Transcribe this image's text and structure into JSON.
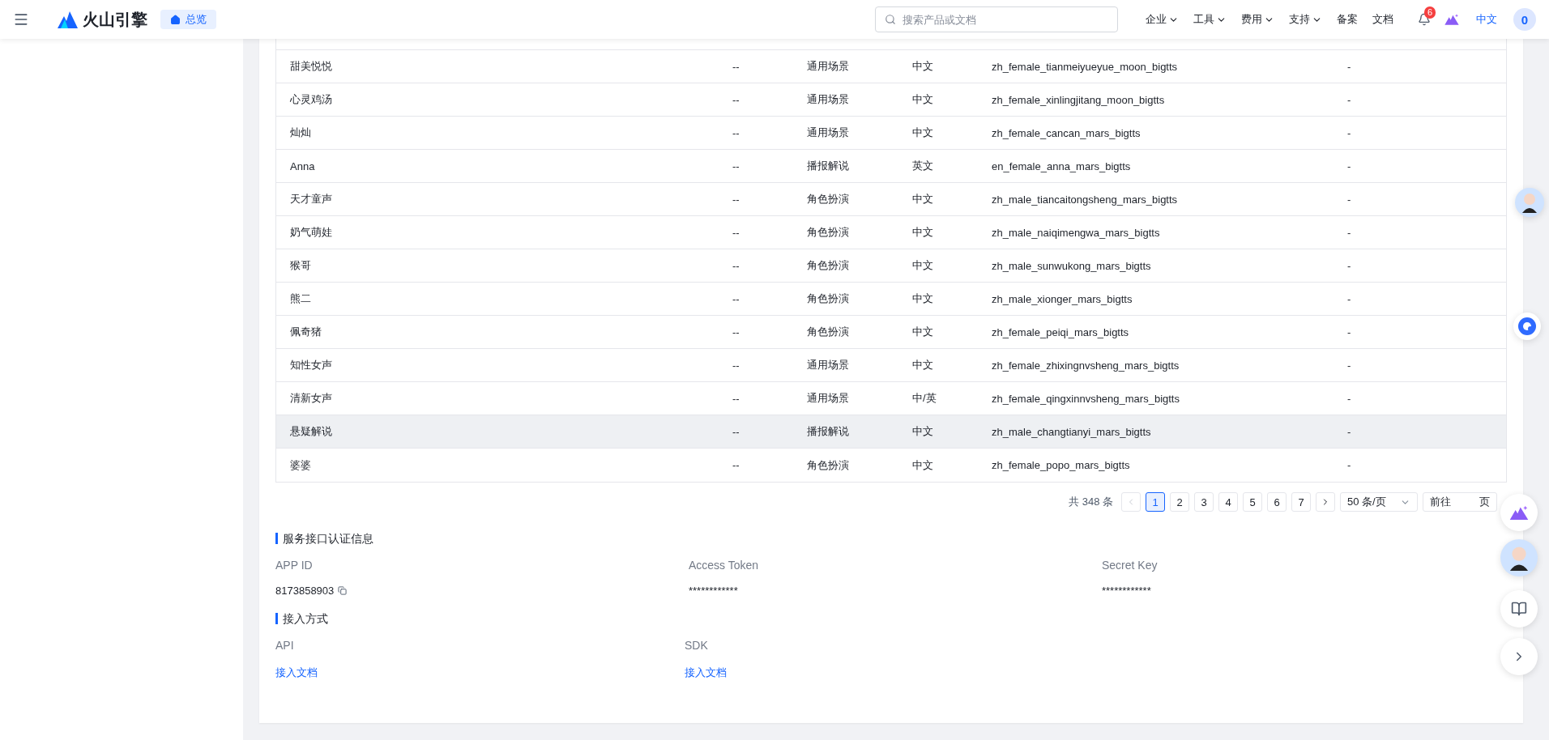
{
  "header": {
    "logo": "火山引擎",
    "home_button": "总览",
    "search": {
      "placeholder": "搜索产品或文档"
    },
    "nav": [
      {
        "label": "企业",
        "dropdown": true
      },
      {
        "label": "工具",
        "dropdown": true
      },
      {
        "label": "费用",
        "dropdown": true
      },
      {
        "label": "支持",
        "dropdown": true
      },
      {
        "label": "备案",
        "dropdown": false
      },
      {
        "label": "文档",
        "dropdown": false
      }
    ],
    "notification_badge": "6",
    "language": {
      "label": "中文",
      "active": true
    },
    "user_avatar": "0"
  },
  "table": {
    "rows": [
      {
        "name": "甜美悦悦",
        "column_2": "--",
        "column_3": "通用场景",
        "column_4": "中文",
        "column_5": "zh_female_tianmeiyueyue_moon_bigtts",
        "column_6": "-",
        "hovered": false
      },
      {
        "name": "心灵鸡汤",
        "column_2": "--",
        "column_3": "通用场景",
        "column_4": "中文",
        "column_5": "zh_female_xinlingjitang_moon_bigtts",
        "column_6": "-",
        "hovered": false
      },
      {
        "name": "灿灿",
        "column_2": "--",
        "column_3": "通用场景",
        "column_4": "中文",
        "column_5": "zh_female_cancan_mars_bigtts",
        "column_6": "-",
        "hovered": false
      },
      {
        "name": "Anna",
        "column_2": "--",
        "column_3": "播报解说",
        "column_4": "英文",
        "column_5": "en_female_anna_mars_bigtts",
        "column_6": "-",
        "hovered": false
      },
      {
        "name": "天才童声",
        "column_2": "--",
        "column_3": "角色扮演",
        "column_4": "中文",
        "column_5": "zh_male_tiancaitongsheng_mars_bigtts",
        "column_6": "-",
        "hovered": false
      },
      {
        "name": "奶气萌娃",
        "column_2": "--",
        "column_3": "角色扮演",
        "column_4": "中文",
        "column_5": "zh_male_naiqimengwa_mars_bigtts",
        "column_6": "-",
        "hovered": false
      },
      {
        "name": "猴哥",
        "column_2": "--",
        "column_3": "角色扮演",
        "column_4": "中文",
        "column_5": "zh_male_sunwukong_mars_bigtts",
        "column_6": "-",
        "hovered": false
      },
      {
        "name": "熊二",
        "column_2": "--",
        "column_3": "角色扮演",
        "column_4": "中文",
        "column_5": "zh_male_xionger_mars_bigtts",
        "column_6": "-",
        "hovered": false
      },
      {
        "name": "佩奇猪",
        "column_2": "--",
        "column_3": "角色扮演",
        "column_4": "中文",
        "column_5": "zh_female_peiqi_mars_bigtts",
        "column_6": "-",
        "hovered": false
      },
      {
        "name": "知性女声",
        "column_2": "--",
        "column_3": "通用场景",
        "column_4": "中文",
        "column_5": "zh_female_zhixingnvsheng_mars_bigtts",
        "column_6": "-",
        "hovered": false
      },
      {
        "name": "清新女声",
        "column_2": "--",
        "column_3": "通用场景",
        "column_4": "中/英",
        "column_5": "zh_female_qingxinnvsheng_mars_bigtts",
        "column_6": "-",
        "hovered": false
      },
      {
        "name": "悬疑解说",
        "column_2": "--",
        "column_3": "播报解说",
        "column_4": "中文",
        "column_5": "zh_male_changtianyi_mars_bigtts",
        "column_6": "-",
        "hovered": true
      },
      {
        "name": "婆婆",
        "column_2": "--",
        "column_3": "角色扮演",
        "column_4": "中文",
        "column_5": "zh_female_popo_mars_bigtts",
        "column_6": "-",
        "hovered": false
      }
    ]
  },
  "pagination": {
    "total": "共 348 条",
    "prev": {
      "disabled": true
    },
    "pages": [
      {
        "label": "1",
        "selected": true
      },
      {
        "label": "2",
        "selected": false
      },
      {
        "label": "3",
        "selected": false
      },
      {
        "label": "4",
        "selected": false
      },
      {
        "label": "5",
        "selected": false
      },
      {
        "label": "6",
        "selected": false
      },
      {
        "label": "7",
        "selected": false
      }
    ],
    "next": {
      "disabled": false
    },
    "page_size": "50 条/页",
    "jump_label": "前往",
    "jump_suffix": "页"
  },
  "auth_section": {
    "title": "服务接口认证信息",
    "fields": [
      {
        "label": "APP ID",
        "value": "8173858903",
        "copyable": true
      },
      {
        "label": "Access Token",
        "value": "************",
        "copyable": false
      },
      {
        "label": "Secret Key",
        "value": "************",
        "copyable": false
      }
    ]
  },
  "access_section": {
    "title": "接入方式",
    "items": [
      {
        "label": "API",
        "link": "接入文档"
      },
      {
        "label": "SDK",
        "link": "接入文档"
      }
    ]
  }
}
